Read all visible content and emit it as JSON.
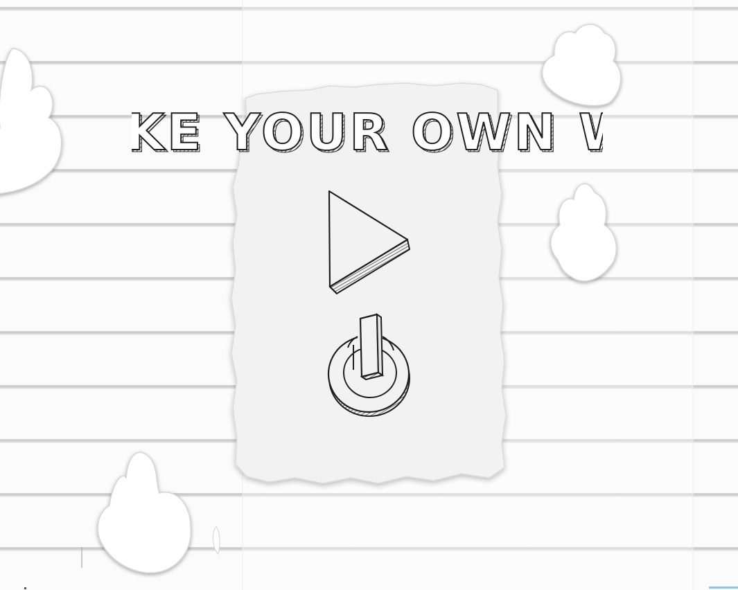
{
  "menu": {
    "title": "MAKE YOUR OWN WAY",
    "play": {
      "icon": "play-icon"
    },
    "power": {
      "icon": "power-icon"
    }
  },
  "colors": {
    "background": "#fbfbfb",
    "ruled_line": "#cfcfcf",
    "paper": "#f2f2f2",
    "ink": "#1e1e1e",
    "corner_accent": "#8ec4e6"
  }
}
